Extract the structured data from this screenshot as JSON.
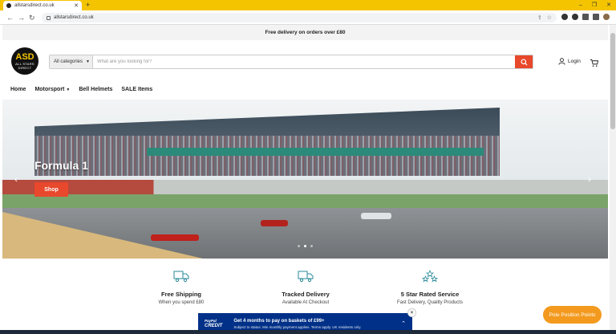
{
  "browser": {
    "tab_title": "allstarsdirect.co.uk",
    "new_tab": "+",
    "url": "allstarsdirect.co.uk",
    "controls": {
      "min": "–",
      "max": "❐",
      "close": "✕"
    }
  },
  "announcement": "Free delivery on orders over £80",
  "logo": {
    "line1": "ASD",
    "line2": "ALL STARS",
    "line3": "DIRECT"
  },
  "search": {
    "category": "All categories",
    "placeholder": "What are you looking for?"
  },
  "header": {
    "login": "Login"
  },
  "nav": [
    "Home",
    "Motorsport",
    "Bell Helmets",
    "SALE Items"
  ],
  "hero": {
    "title": "Formula 1",
    "cta": "Shop",
    "slides": 3,
    "active_slide": 2
  },
  "features": [
    {
      "title": "Free Shipping",
      "subtitle": "When you spend £80",
      "icon": "truck-icon"
    },
    {
      "title": "Tracked Delivery",
      "subtitle": "Available At Checkout",
      "icon": "truck-icon"
    },
    {
      "title": "5 Star Rated Service",
      "subtitle": "Fast Delivery, Quality Products",
      "icon": "stars-icon"
    }
  ],
  "paypal": {
    "brand1": "PayPal",
    "brand2": "CREDIT",
    "headline": "Get 4 months to pay on baskets of £99+",
    "terms": "Subject to status. Min monthly payment applies. Terms apply. UK residents only."
  },
  "rewards": "Pole Position Points",
  "colors": {
    "accent": "#e8482b",
    "tabbar": "#f4c400",
    "paypal": "#003087",
    "rewards": "#f39a1e"
  }
}
